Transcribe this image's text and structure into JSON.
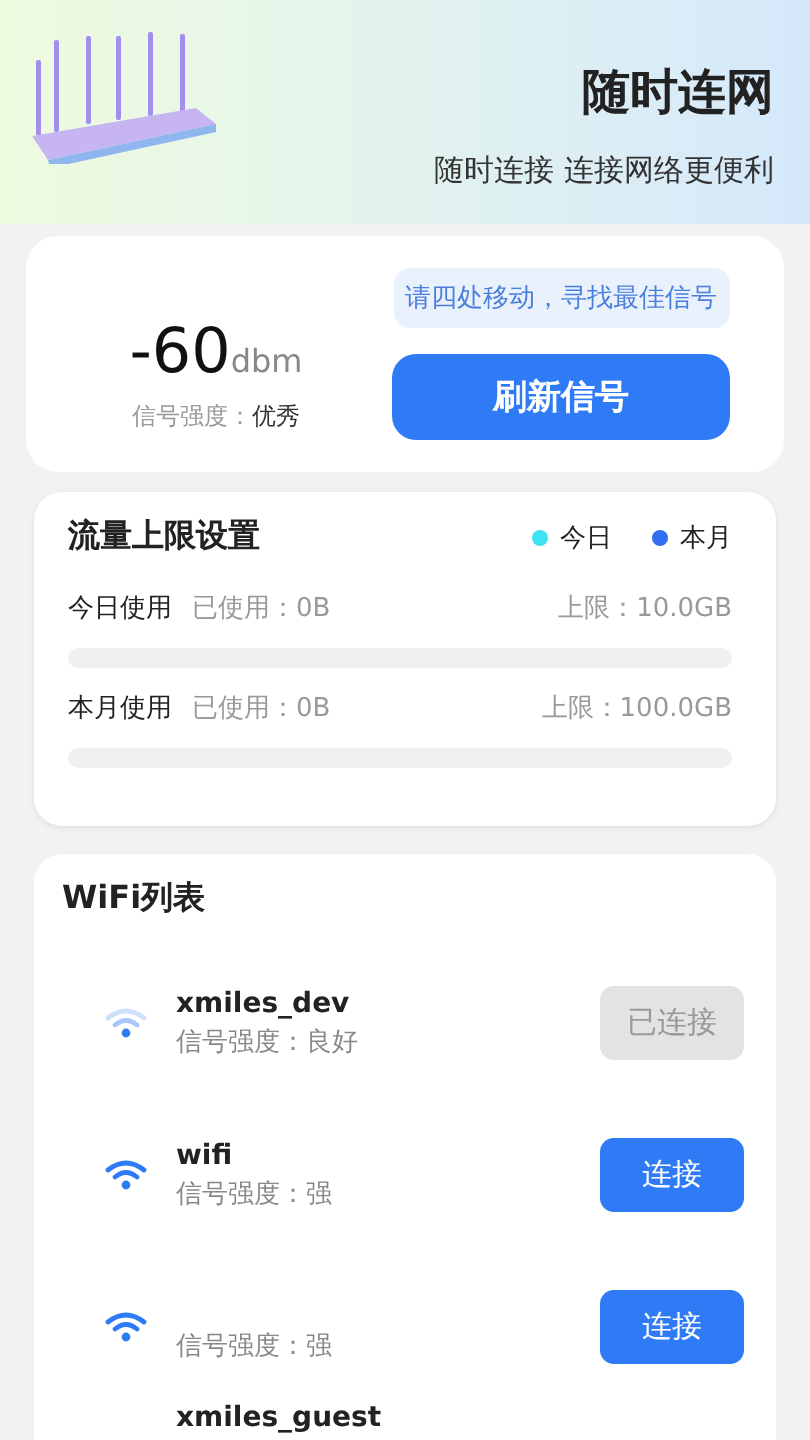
{
  "header": {
    "title": "随时连网",
    "subtitle": "随时连接 连接网络更便利"
  },
  "signal_card": {
    "value": "-60",
    "unit": "dbm",
    "strength_label": "信号强度：",
    "strength_value": "优秀",
    "tip": "请四处移动，寻找最佳信号",
    "button": "刷新信号"
  },
  "traffic_card": {
    "title": "流量上限设置",
    "legend": [
      {
        "label": "今日",
        "color": "#3de3f0"
      },
      {
        "label": "本月",
        "color": "#2f6ff0"
      }
    ],
    "rows": [
      {
        "label": "今日使用",
        "used": "已使用：0B",
        "limit": "上限：10.0GB",
        "level": 0
      },
      {
        "label": "本月使用",
        "used": "已使用：0B",
        "limit": "上限：100.0GB",
        "level": 0
      }
    ]
  },
  "wifi_list": {
    "title": "WiFi列表",
    "items": [
      {
        "name": "xmiles_dev",
        "strength": "信号强度：良好",
        "weak_signal": true,
        "connected": true,
        "button": "已连接"
      },
      {
        "name": "wifi",
        "strength": "信号强度：强",
        "weak_signal": false,
        "connected": false,
        "button": "连接"
      },
      {
        "strength": "信号强度：强",
        "weak_signal": false,
        "connected": false,
        "button": "连接"
      },
      {
        "name": "xmiles_guest"
      }
    ]
  }
}
